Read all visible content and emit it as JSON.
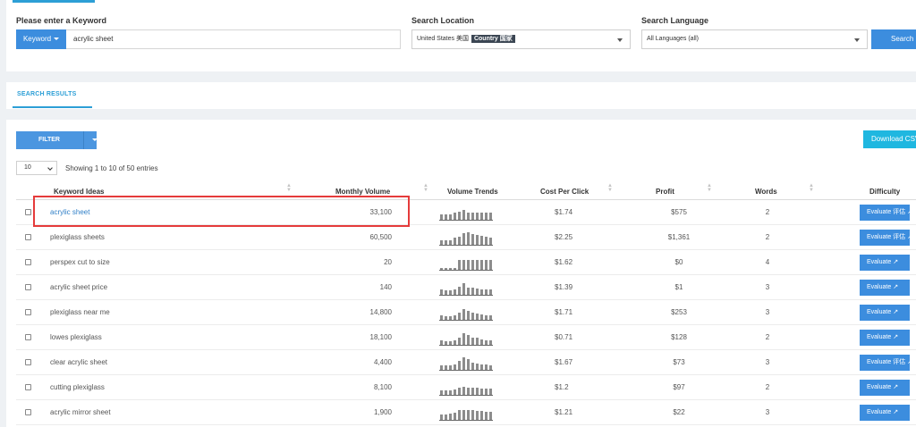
{
  "search": {
    "keyword_label": "Please enter a Keyword",
    "keyword_type_button": "Keyword",
    "keyword_value": "acrylic sheet",
    "location_label": "Search Location",
    "location_value": "United States 美国",
    "location_badge": "Country 国家",
    "language_label": "Search Language",
    "language_value": "All Languages (all)",
    "search_button": "Search"
  },
  "tabs": {
    "results_label": "SEARCH RESULTS"
  },
  "results": {
    "filter_button": "FILTER",
    "download_button": "Download CSV",
    "page_length": "10",
    "showing_text": "Showing 1 to 10 of 50 entries",
    "columns": [
      "Keyword Ideas",
      "Monthly Volume",
      "Volume Trends",
      "Cost Per Click",
      "Profit",
      "Words",
      "Difficulty"
    ],
    "rows": [
      {
        "keyword": "acrylic sheet",
        "volume": "33,100",
        "cpc": "$1.74",
        "profit": "$575",
        "words": "2",
        "evaluate": "Evaluate 评估",
        "trend": [
          0.4,
          0.4,
          0.4,
          0.55,
          0.6,
          0.7,
          0.55,
          0.5,
          0.5,
          0.5,
          0.5,
          0.5
        ]
      },
      {
        "keyword": "plexiglass sheets",
        "volume": "60,500",
        "cpc": "$2.25",
        "profit": "$1,361",
        "words": "2",
        "evaluate": "Evaluate 评估",
        "trend": [
          0.3,
          0.3,
          0.3,
          0.5,
          0.6,
          0.85,
          0.9,
          0.8,
          0.7,
          0.65,
          0.6,
          0.5
        ]
      },
      {
        "keyword": "perspex cut to size",
        "volume": "20",
        "cpc": "$1.62",
        "profit": "$0",
        "words": "4",
        "evaluate": "Evaluate",
        "trend": [
          0.1,
          0.1,
          0.1,
          0.1,
          0.75,
          0.75,
          0.75,
          0.75,
          0.75,
          0.75,
          0.75,
          0.75
        ]
      },
      {
        "keyword": "acrylic sheet price",
        "volume": "140",
        "cpc": "$1.39",
        "profit": "$1",
        "words": "3",
        "evaluate": "Evaluate",
        "trend": [
          0.4,
          0.3,
          0.3,
          0.4,
          0.6,
          0.85,
          0.55,
          0.5,
          0.45,
          0.4,
          0.4,
          0.4
        ]
      },
      {
        "keyword": "plexiglass near me",
        "volume": "14,800",
        "cpc": "$1.71",
        "profit": "$253",
        "words": "3",
        "evaluate": "Evaluate",
        "trend": [
          0.3,
          0.25,
          0.25,
          0.35,
          0.5,
          0.8,
          0.65,
          0.5,
          0.45,
          0.4,
          0.35,
          0.3
        ]
      },
      {
        "keyword": "lowes plexiglass",
        "volume": "18,100",
        "cpc": "$0.71",
        "profit": "$128",
        "words": "2",
        "evaluate": "Evaluate",
        "trend": [
          0.3,
          0.25,
          0.25,
          0.35,
          0.55,
          0.85,
          0.7,
          0.55,
          0.5,
          0.4,
          0.35,
          0.3
        ]
      },
      {
        "keyword": "clear acrylic sheet",
        "volume": "4,400",
        "cpc": "$1.67",
        "profit": "$73",
        "words": "3",
        "evaluate": "Evaluate 评估",
        "trend": [
          0.3,
          0.3,
          0.3,
          0.4,
          0.65,
          0.95,
          0.8,
          0.55,
          0.45,
          0.4,
          0.4,
          0.35
        ]
      },
      {
        "keyword": "cutting plexiglass",
        "volume": "8,100",
        "cpc": "$1.2",
        "profit": "$97",
        "words": "2",
        "evaluate": "Evaluate",
        "trend": [
          0.3,
          0.35,
          0.35,
          0.4,
          0.5,
          0.6,
          0.55,
          0.5,
          0.5,
          0.45,
          0.45,
          0.45
        ]
      },
      {
        "keyword": "acrylic mirror sheet",
        "volume": "1,900",
        "cpc": "$1.21",
        "profit": "$22",
        "words": "3",
        "evaluate": "Evaluate",
        "trend": [
          0.4,
          0.4,
          0.45,
          0.55,
          0.7,
          0.75,
          0.7,
          0.7,
          0.65,
          0.65,
          0.6,
          0.6
        ]
      }
    ]
  }
}
